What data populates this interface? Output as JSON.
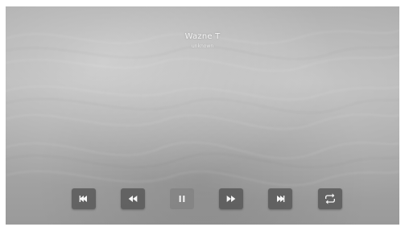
{
  "now_playing": {
    "title": "Wazne T",
    "subtitle": "unknown"
  },
  "controls": [
    {
      "id": "previous",
      "icon": "skip-previous-icon"
    },
    {
      "id": "rewind",
      "icon": "rewind-icon"
    },
    {
      "id": "pause",
      "icon": "pause-icon"
    },
    {
      "id": "fast_forward",
      "icon": "fast-forward-icon"
    },
    {
      "id": "next",
      "icon": "skip-next-icon"
    },
    {
      "id": "repeat",
      "icon": "repeat-icon"
    }
  ],
  "colors": {
    "control_bg": "#505050",
    "text": "#f4f4f4"
  }
}
